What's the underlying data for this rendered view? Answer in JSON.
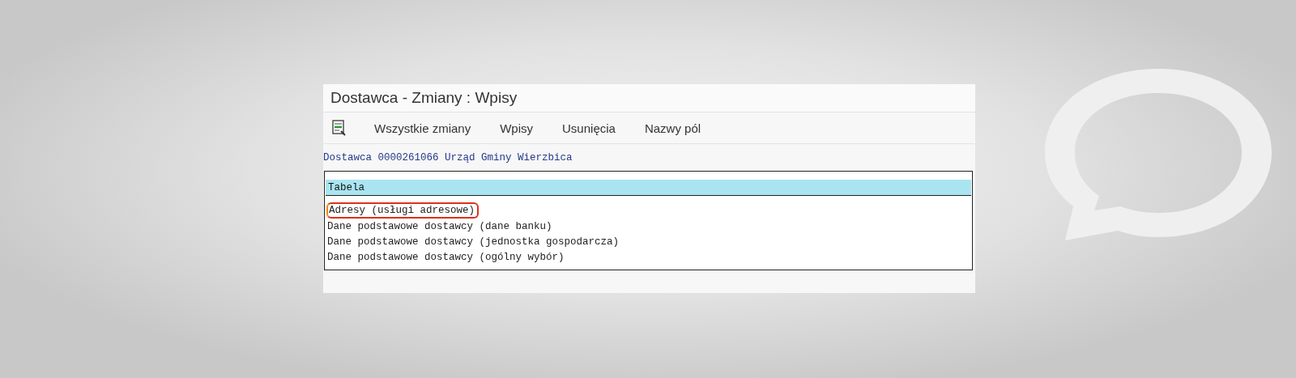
{
  "window": {
    "title": "Dostawca - Zmiany : Wpisy"
  },
  "toolbar": {
    "items": [
      "Wszystkie zmiany",
      "Wpisy",
      "Usunięcia",
      "Nazwy pól"
    ]
  },
  "subject": "Dostawca 0000261066 Urząd Gminy Wierzbica",
  "table": {
    "header": "Tabela",
    "rows": [
      {
        "text": "Adresy (usługi adresowe)",
        "highlighted": true
      },
      {
        "text": "Dane podstawowe dostawcy (dane banku)",
        "highlighted": false
      },
      {
        "text": "Dane podstawowe dostawcy (jednostka gospodarcza)",
        "highlighted": false
      },
      {
        "text": "Dane podstawowe dostawcy (ogólny wybór)",
        "highlighted": false
      }
    ]
  }
}
